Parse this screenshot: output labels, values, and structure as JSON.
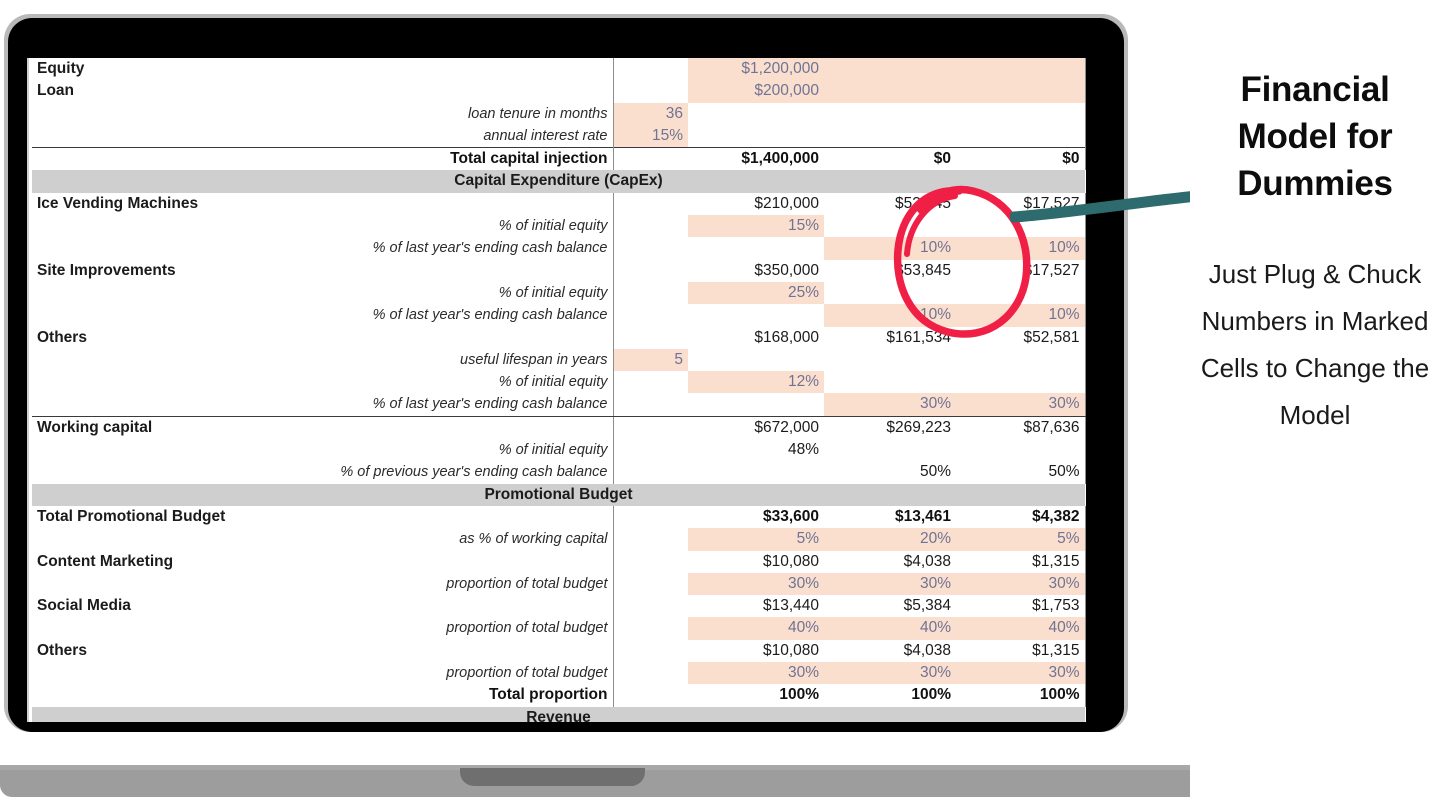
{
  "promo": {
    "headline": "Financial Model for Dummies",
    "subline": "Just Plug & Chuck Numbers in Marked Cells to Change the Model",
    "arrow_icon": "arrow-right-icon",
    "circle_icon": "circle-highlight-icon",
    "accent_teal": "#2d6b6f",
    "accent_red": "#f01f45"
  },
  "spreadsheet": {
    "input_cell_color": "#fbdfce",
    "band_color": "#cfcfcf",
    "rows": [
      {
        "type": "data",
        "label": "Equity",
        "narrow": "",
        "a": "$1,200,000",
        "b": "",
        "c": "",
        "style": "label",
        "a_hl": true,
        "b_hl": true,
        "c_hl": true
      },
      {
        "type": "data",
        "label": "Loan",
        "narrow": "",
        "a": "$200,000",
        "b": "",
        "c": "",
        "style": "label",
        "a_hl": true,
        "b_hl": true,
        "c_hl": true
      },
      {
        "type": "data",
        "label": "loan tenure in months",
        "narrow": "36",
        "a": "",
        "b": "",
        "c": "",
        "style": "sub",
        "n_hl": true
      },
      {
        "type": "data",
        "label": "annual interest rate",
        "narrow": "15%",
        "a": "",
        "b": "",
        "c": "",
        "style": "sub",
        "n_hl": true
      },
      {
        "type": "total",
        "label": "Total capital injection",
        "narrow": "",
        "a": "$1,400,000",
        "b": "$0",
        "c": "$0",
        "style": "total"
      },
      {
        "type": "band",
        "label": "Capital Expenditure (CapEx)"
      },
      {
        "type": "data",
        "label": "Ice Vending Machines",
        "narrow": "",
        "a": "$210,000",
        "b": "$53,845",
        "c": "$17,527",
        "style": "label"
      },
      {
        "type": "data",
        "label": "% of initial equity",
        "narrow": "",
        "a": "15%",
        "b": "",
        "c": "",
        "style": "sub",
        "a_hl": true
      },
      {
        "type": "data",
        "label": "% of last year's ending cash balance",
        "narrow": "",
        "a": "",
        "b": "10%",
        "c": "10%",
        "style": "sub",
        "b_hl": true,
        "c_hl": true
      },
      {
        "type": "data",
        "label": "Site Improvements",
        "narrow": "",
        "a": "$350,000",
        "b": "$53,845",
        "c": "$17,527",
        "style": "label"
      },
      {
        "type": "data",
        "label": "% of initial equity",
        "narrow": "",
        "a": "25%",
        "b": "",
        "c": "",
        "style": "sub",
        "a_hl": true
      },
      {
        "type": "data",
        "label": "% of last year's ending cash balance",
        "narrow": "",
        "a": "",
        "b": "10%",
        "c": "10%",
        "style": "sub",
        "b_hl": true,
        "c_hl": true
      },
      {
        "type": "data",
        "label": "Others",
        "narrow": "",
        "a": "$168,000",
        "b": "$161,534",
        "c": "$52,581",
        "style": "label"
      },
      {
        "type": "data",
        "label": "useful lifespan in years",
        "narrow": "5",
        "a": "",
        "b": "",
        "c": "",
        "style": "sub",
        "n_hl": true
      },
      {
        "type": "data",
        "label": "% of initial equity",
        "narrow": "",
        "a": "12%",
        "b": "",
        "c": "",
        "style": "sub",
        "a_hl": true
      },
      {
        "type": "data",
        "label": "% of last year's ending cash balance",
        "narrow": "",
        "a": "",
        "b": "30%",
        "c": "30%",
        "style": "sub",
        "b_hl": true,
        "c_hl": true,
        "rule_after": true
      },
      {
        "type": "data",
        "label": "Working capital",
        "narrow": "",
        "a": "$672,000",
        "b": "$269,223",
        "c": "$87,636",
        "style": "label"
      },
      {
        "type": "data",
        "label": "% of initial equity",
        "narrow": "",
        "a": "48%",
        "b": "",
        "c": "",
        "style": "sub"
      },
      {
        "type": "data",
        "label": "% of previous year's ending cash balance",
        "narrow": "",
        "a": "",
        "b": "50%",
        "c": "50%",
        "style": "sub"
      },
      {
        "type": "band",
        "label": "Promotional Budget"
      },
      {
        "type": "data",
        "label": "Total Promotional Budget",
        "narrow": "",
        "a": "$33,600",
        "b": "$13,461",
        "c": "$4,382",
        "style": "label",
        "bold_nums": true
      },
      {
        "type": "data",
        "label": "as % of working capital",
        "narrow": "",
        "a": "5%",
        "b": "20%",
        "c": "5%",
        "style": "sub",
        "a_hl": true,
        "b_hl": true,
        "c_hl": true
      },
      {
        "type": "data",
        "label": "Content Marketing",
        "narrow": "",
        "a": "$10,080",
        "b": "$4,038",
        "c": "$1,315",
        "style": "label"
      },
      {
        "type": "data",
        "label": "proportion of total budget",
        "narrow": "",
        "a": "30%",
        "b": "30%",
        "c": "30%",
        "style": "sub",
        "a_hl": true,
        "b_hl": true,
        "c_hl": true
      },
      {
        "type": "data",
        "label": "Social Media",
        "narrow": "",
        "a": "$13,440",
        "b": "$5,384",
        "c": "$1,753",
        "style": "label"
      },
      {
        "type": "data",
        "label": "proportion of total budget",
        "narrow": "",
        "a": "40%",
        "b": "40%",
        "c": "40%",
        "style": "sub",
        "a_hl": true,
        "b_hl": true,
        "c_hl": true
      },
      {
        "type": "data",
        "label": "Others",
        "narrow": "",
        "a": "$10,080",
        "b": "$4,038",
        "c": "$1,315",
        "style": "label"
      },
      {
        "type": "data",
        "label": "proportion of total budget",
        "narrow": "",
        "a": "30%",
        "b": "30%",
        "c": "30%",
        "style": "sub",
        "a_hl": true,
        "b_hl": true,
        "c_hl": true
      },
      {
        "type": "data",
        "label": "Total proportion",
        "narrow": "",
        "a": "100%",
        "b": "100%",
        "c": "100%",
        "style": "sub-bold"
      },
      {
        "type": "band",
        "label": "Revenue"
      }
    ]
  }
}
